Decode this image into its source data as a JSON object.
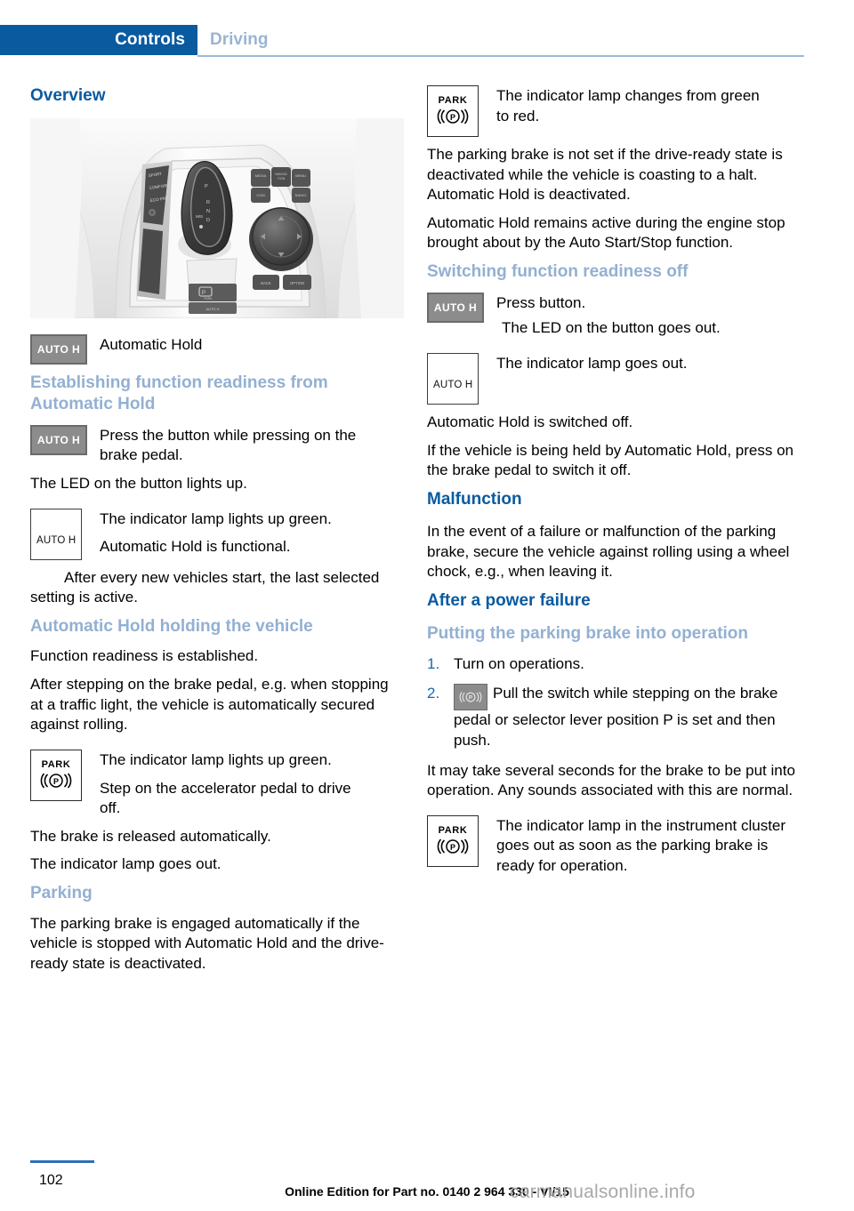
{
  "header": {
    "chapter": "Controls",
    "section": "Driving"
  },
  "left_column": {
    "overview_heading": "Overview",
    "console_caption": "Automatic Hold",
    "console_caption_icon": "AUTO H",
    "establishing_heading": "Establishing function readiness from Automatic Hold",
    "establishing_icon": "AUTO H",
    "establishing_line1": "Press the button while pressing on the",
    "establishing_line2": "brake pedal.",
    "led_lights_up": "The LED on the button lights up.",
    "lamp_icon": "AUTO H",
    "lamp_green": "The indicator lamp lights up green.",
    "lamp_functional": "Automatic Hold is functional.",
    "after_start_line1": "After every new vehicles start, the last",
    "after_start_line2": "selected setting is active.",
    "holding_heading": "Automatic Hold holding the vehicle",
    "holding_p1": "Function readiness is established.",
    "holding_p2": "After stepping on the brake pedal, e.g. when stopping at a traffic light, the vehicle is automatically secured against rolling.",
    "park_icon_word": "PARK",
    "park_green": "The indicator lamp lights up green.",
    "park_accelerate_line1": "Step on the accelerator pedal to drive",
    "park_accelerate_line2": "off.",
    "brake_released": "The brake is released automatically.",
    "lamp_goes_out": "The indicator lamp goes out.",
    "parking_heading": "Parking",
    "parking_p1": "The parking brake is engaged automatically if the vehicle is stopped with Automatic Hold and the drive-ready state is deactivated."
  },
  "right_column": {
    "park_icon_word": "PARK",
    "park_changes_line1": "The indicator lamp changes from green",
    "park_changes_line2": "to red.",
    "not_set_p": "The parking brake is not set if the drive-ready state is deactivated while the vehicle is coasting to a halt. Automatic Hold is deactivated.",
    "remains_active_p": "Automatic Hold remains active during the engine stop brought about by the Auto Start/Stop function.",
    "switching_off_heading": "Switching function readiness off",
    "switch_icon": "AUTO H",
    "press_button": "Press button.",
    "led_goes_out": "The LED on the button goes out.",
    "lamp_icon": "AUTO H",
    "lamp_goes_out": "The indicator lamp goes out.",
    "switched_off": "Automatic Hold is switched off.",
    "held_by_hold_p": "If the vehicle is being held by Automatic Hold, press on the brake pedal to switch it off.",
    "malfunction_heading": "Malfunction",
    "malfunction_p": "In the event of a failure or malfunction of the parking brake, secure the vehicle against rolling using a wheel chock, e.g., when leaving it.",
    "power_failure_heading": "After a power failure",
    "putting_into_operation_heading": "Putting the parking brake into operation",
    "steps": [
      {
        "num": "1.",
        "text": "Turn on operations."
      },
      {
        "num": "2.",
        "text": "Pull the switch while stepping on the brake pedal or selector lever position P is set and then push."
      }
    ],
    "several_seconds_p": "It may take several seconds for the brake to be put into operation. Any sounds associated with this are normal.",
    "final_park_icon_word": "PARK",
    "final_park_text": "The indicator lamp in the instrument cluster goes out as soon as the parking brake is ready for operation."
  },
  "footer": {
    "page_number": "102",
    "edition": "Online Edition for Part no. 0140 2 964 330 - VI/15",
    "watermark": "carmanualsonline.info"
  },
  "colors": {
    "chapter_bar": "#0a5aa0",
    "heading_major": "#0a5aa0",
    "heading_sub": "#93b0d2",
    "section_label": "#9bb4d4",
    "list_number": "#1668b3",
    "icon_gray": "#8c8c8c",
    "footer_rule": "#2f6fb5"
  }
}
